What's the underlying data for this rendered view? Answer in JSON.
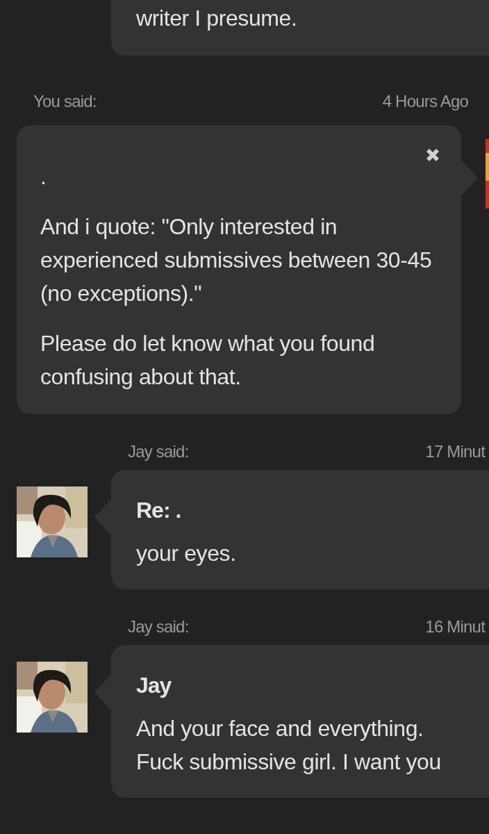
{
  "messages": [
    {
      "kind": "partial",
      "body": [
        "writer I presume."
      ]
    },
    {
      "kind": "own",
      "author_label": "You said:",
      "time": "4 Hours Ago",
      "closable": true,
      "title": ".",
      "body": [
        "And i quote: \"Only interested in experienced submissives between 30-45 (no exceptions).\"",
        "Please do let know what you found confusing about that."
      ]
    },
    {
      "kind": "other",
      "author_label": "Jay said:",
      "time": "17 Minut",
      "title": "Re: .",
      "body": [
        "your eyes."
      ]
    },
    {
      "kind": "other",
      "author_label": "Jay said:",
      "time": "16 Minut",
      "title": "Jay",
      "body": [
        "And your face and everything. Fuck submissive girl. I want you"
      ]
    }
  ]
}
